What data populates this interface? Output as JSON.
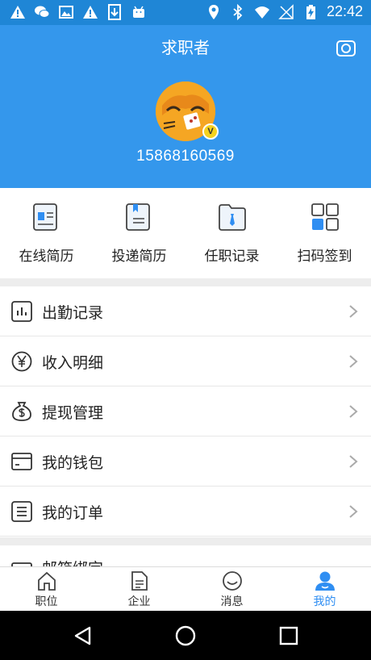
{
  "status_bar": {
    "time": "22:42",
    "left_icons": [
      "warning-icon",
      "wechat-icon",
      "image-icon",
      "warning-icon",
      "download-icon",
      "android-icon"
    ],
    "right_icons": [
      "location-icon",
      "bluetooth-icon",
      "wifi-icon",
      "no-signal-icon",
      "battery-charging-icon"
    ]
  },
  "header": {
    "title": "求职者",
    "phone": "15868160569",
    "badge": "V"
  },
  "actions": [
    {
      "label": "在线简历",
      "icon": "resume-icon"
    },
    {
      "label": "投递简历",
      "icon": "send-resume-icon"
    },
    {
      "label": "任职记录",
      "icon": "job-record-icon"
    },
    {
      "label": "扫码签到",
      "icon": "qr-signin-icon"
    }
  ],
  "menu": [
    {
      "label": "出勤记录",
      "icon": "attendance-chart-icon"
    },
    {
      "label": "收入明细",
      "icon": "yen-icon"
    },
    {
      "label": "提现管理",
      "icon": "dollar-bag-icon"
    },
    {
      "label": "我的钱包",
      "icon": "wallet-icon"
    },
    {
      "label": "我的订单",
      "icon": "order-list-icon"
    }
  ],
  "partial_item": {
    "label": "邮箱绑定"
  },
  "tabs": [
    {
      "label": "职位",
      "icon": "home-icon",
      "active": false
    },
    {
      "label": "企业",
      "icon": "document-icon",
      "active": false
    },
    {
      "label": "消息",
      "icon": "smile-icon",
      "active": false
    },
    {
      "label": "我的",
      "icon": "user-icon",
      "active": true
    }
  ],
  "colors": {
    "primary": "#3497ec",
    "active_tab": "#2f8ef2"
  }
}
